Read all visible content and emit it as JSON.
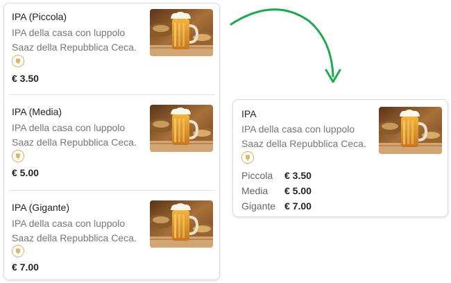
{
  "menu_items": [
    {
      "name": "IPA (Piccola)",
      "desc": "IPA della casa con luppolo Saaz della Repubblica Ceca.",
      "price": "€ 3.50"
    },
    {
      "name": "IPA (Media)",
      "desc": "IPA della casa con luppolo Saaz della Repubblica Ceca.",
      "price": "€ 5.00"
    },
    {
      "name": "IPA (Gigante)",
      "desc": "IPA della casa con luppolo Saaz della Repubblica Ceca.",
      "price": "€ 7.00"
    }
  ],
  "merged_item": {
    "name": "IPA",
    "desc": "IPA della casa con luppolo Saaz della Repubblica Ceca.",
    "sizes": [
      {
        "label": "Piccola",
        "price": "€ 3.50"
      },
      {
        "label": "Media",
        "price": "€ 5.00"
      },
      {
        "label": "Gigante",
        "price": "€ 7.00"
      }
    ]
  },
  "icons": {
    "allergen": "wheat-icon",
    "photo": "beer-mug-photo",
    "arrow": "curved-arrow"
  },
  "colors": {
    "arrow": "#1fa84f",
    "badge": "#d9b26a",
    "border": "#dcdcdc"
  }
}
